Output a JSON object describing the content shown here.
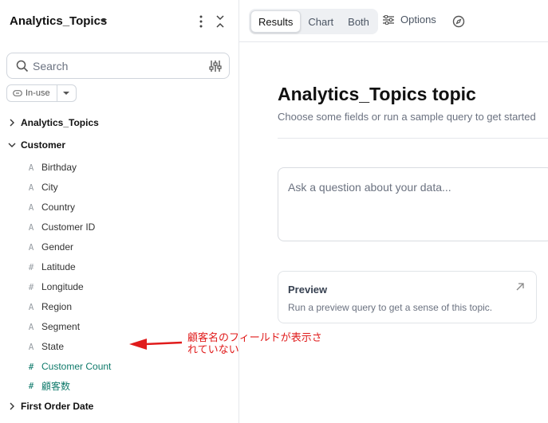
{
  "sidebar": {
    "title": "Analytics_Topics",
    "search": {
      "placeholder": "Search",
      "value": ""
    },
    "filter_chip": "In-use",
    "tree": [
      {
        "label": "Analytics_Topics",
        "expanded": false
      },
      {
        "label": "Customer",
        "expanded": true
      },
      {
        "label": "First Order Date",
        "expanded": false
      }
    ],
    "customer_fields": [
      {
        "label": "Birthday",
        "icon": "A",
        "kind": "dimension"
      },
      {
        "label": "City",
        "icon": "A",
        "kind": "dimension"
      },
      {
        "label": "Country",
        "icon": "A",
        "kind": "dimension"
      },
      {
        "label": "Customer ID",
        "icon": "A",
        "kind": "dimension"
      },
      {
        "label": "Gender",
        "icon": "A",
        "kind": "dimension"
      },
      {
        "label": "Latitude",
        "icon": "#",
        "kind": "dimension"
      },
      {
        "label": "Longitude",
        "icon": "#",
        "kind": "dimension"
      },
      {
        "label": "Region",
        "icon": "A",
        "kind": "dimension"
      },
      {
        "label": "Segment",
        "icon": "A",
        "kind": "dimension"
      },
      {
        "label": "State",
        "icon": "A",
        "kind": "dimension"
      },
      {
        "label": "Customer Count",
        "icon": "#",
        "kind": "measure"
      },
      {
        "label": "顧客数",
        "icon": "#",
        "kind": "measure"
      }
    ]
  },
  "annotation": {
    "text": "顧客名のフィールドが表示されていない",
    "color": "#e01b1b"
  },
  "toolbar": {
    "tabs": [
      {
        "label": "Results",
        "active": true
      },
      {
        "label": "Chart",
        "active": false
      },
      {
        "label": "Both",
        "active": false
      }
    ],
    "options_label": "Options"
  },
  "main": {
    "title": "Analytics_Topics topic",
    "subtitle": "Choose some fields or run a sample query to get started",
    "ask_placeholder": "Ask a question about your data...",
    "preview": {
      "title": "Preview",
      "description": "Run a preview query to get a sense of this topic."
    }
  },
  "colors": {
    "measure": "#0f7a6b",
    "accent_red": "#e01b1b"
  }
}
